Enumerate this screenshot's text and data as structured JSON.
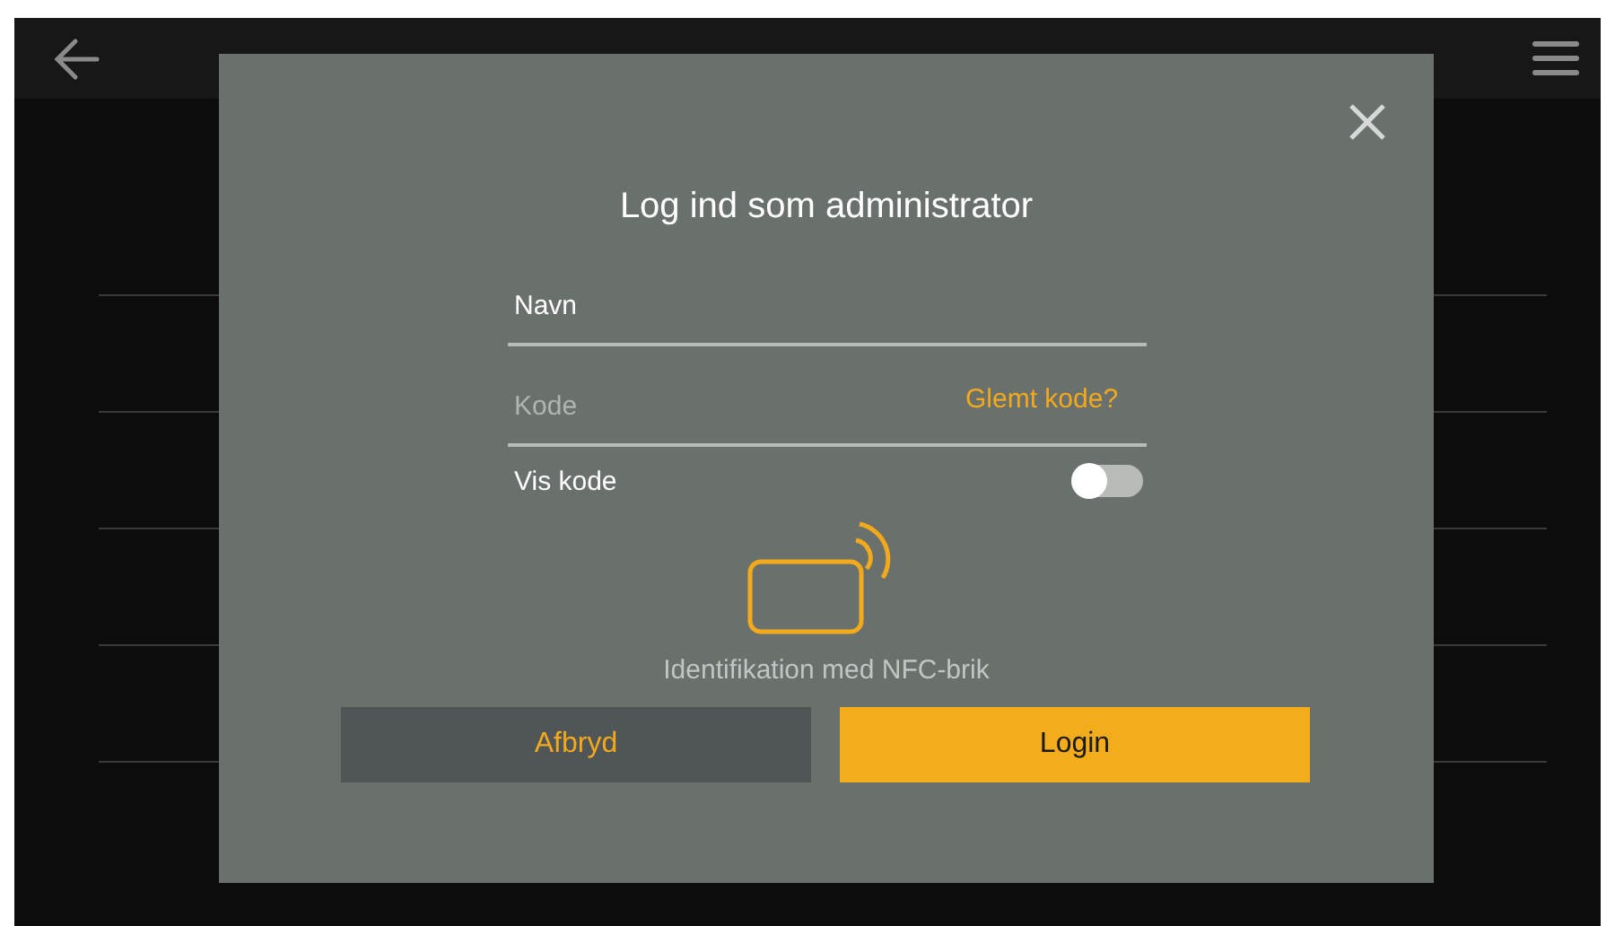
{
  "dialog": {
    "title": "Log ind som administrator",
    "name_field": {
      "value": "Navn"
    },
    "password_field": {
      "placeholder": "Kode",
      "link": "Glemt kode?"
    },
    "show_password": {
      "label": "Vis kode",
      "on": false
    },
    "nfc_caption": "Identifikation med NFC-brik",
    "buttons": [
      {
        "label": "Afbryd",
        "kind": "secondary"
      },
      {
        "label": "Login",
        "kind": "primary"
      }
    ]
  }
}
